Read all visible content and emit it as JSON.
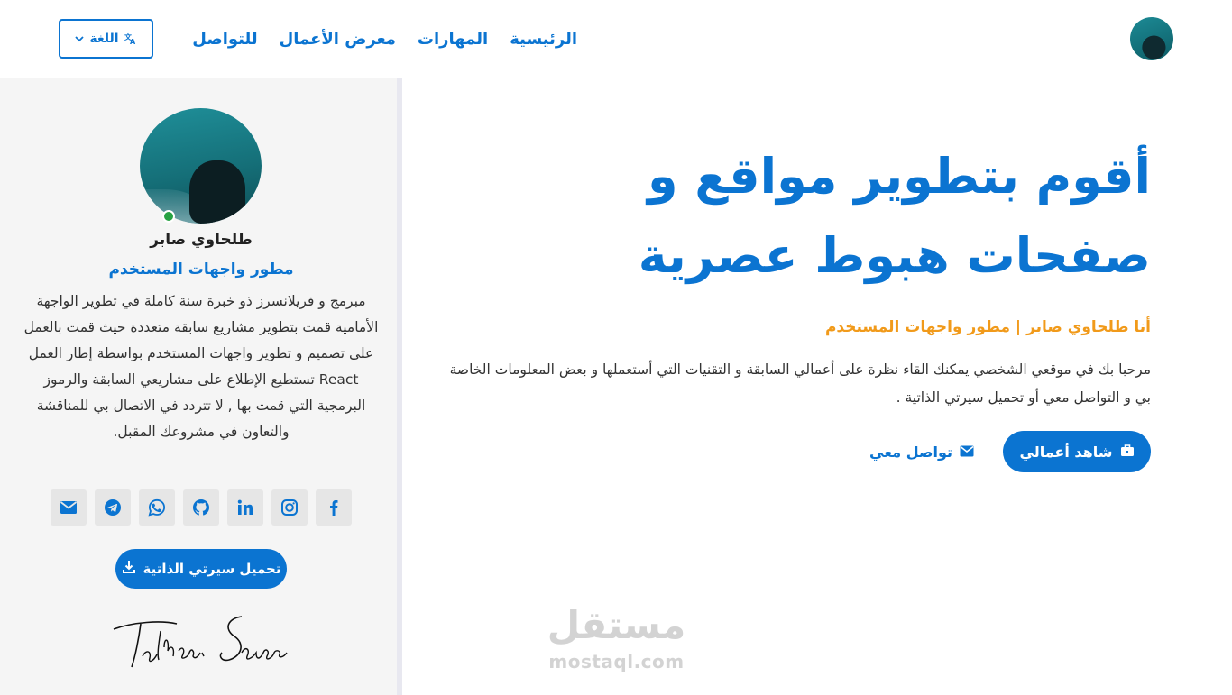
{
  "nav": {
    "links": [
      "الرئيسية",
      "المهارات",
      "معرض الأعمال",
      "للتواصل"
    ],
    "language_label": "اللغة"
  },
  "sidebar": {
    "name": "طلحاوي صابر",
    "role": "مطور واجهات المستخدم",
    "bio": "مبرمج و فريلانسرز ذو خبرة سنة كاملة في تطوير الواجهة الأمامية قمت بتطوير مشاريع سابقة متعددة حيث قمت بالعمل على تصميم و تطوير واجهات المستخدم بواسطة إطار العمل React تستطيع الإطلاع على مشاريعي السابقة والرموز البرمجية التي قمت بها , لا تتردد في الاتصال بي للمناقشة والتعاون في مشروعك المقبل.",
    "socials": [
      "facebook-icon",
      "instagram-icon",
      "linkedin-icon",
      "github-icon",
      "whatsapp-icon",
      "telegram-icon",
      "email-icon"
    ],
    "cv_button": "تحميل سيرتي الذاتية",
    "signature_text": "Talhaoui Saber"
  },
  "hero": {
    "title": "أقوم بتطوير مواقع و صفحات هبوط عصرية",
    "subtitle": "أنا طلحاوي صابر | مطور واجهات المستخدم",
    "text": "مرحبا بك في موقعي الشخصي يمكنك القاء نظرة على أعمالي السابقة و التقنيات التي أستعملها و بعض المعلومات الخاصة بي و التواصل معي أو تحميل سيرتي الذاتية .",
    "btn_works": "شاهد أعمالي",
    "btn_contact": "تواصل معي"
  },
  "watermark": {
    "ar": "مستقل",
    "en": "mostaql.com"
  },
  "colors": {
    "primary": "#0b74d1",
    "accent": "#f19a1a",
    "online": "#27a243"
  }
}
